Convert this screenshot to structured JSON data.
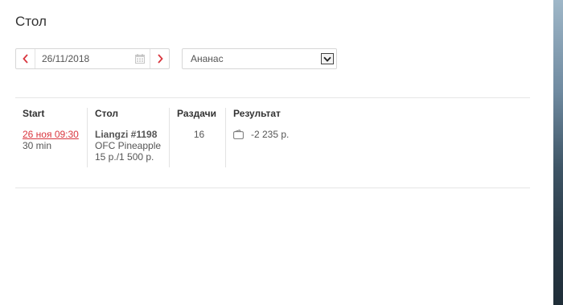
{
  "page": {
    "title": "Стол"
  },
  "filters": {
    "date_value": "26/11/2018",
    "prev_icon": "chevron-left-icon",
    "next_icon": "chevron-right-icon",
    "calendar_icon": "calendar-icon",
    "game_select_value": "Ананас",
    "dropdown_icon": "chevron-down-icon"
  },
  "table": {
    "headers": {
      "start": "Start",
      "table": "Стол",
      "hands": "Раздачи",
      "result": "Результат"
    },
    "rows": [
      {
        "start_time": "26 ноя 09:30",
        "duration": "30 min",
        "table_name": "Liangzi #1198",
        "game_type": "OFC Pineapple",
        "stakes": "15 р./1 500 р.",
        "hands": "16",
        "result": "-2 235 р.",
        "result_icon": "wallet-icon"
      }
    ]
  },
  "colors": {
    "accent": "#d9363e",
    "text": "#333333",
    "muted": "#555555",
    "border": "#d7d7d7"
  }
}
